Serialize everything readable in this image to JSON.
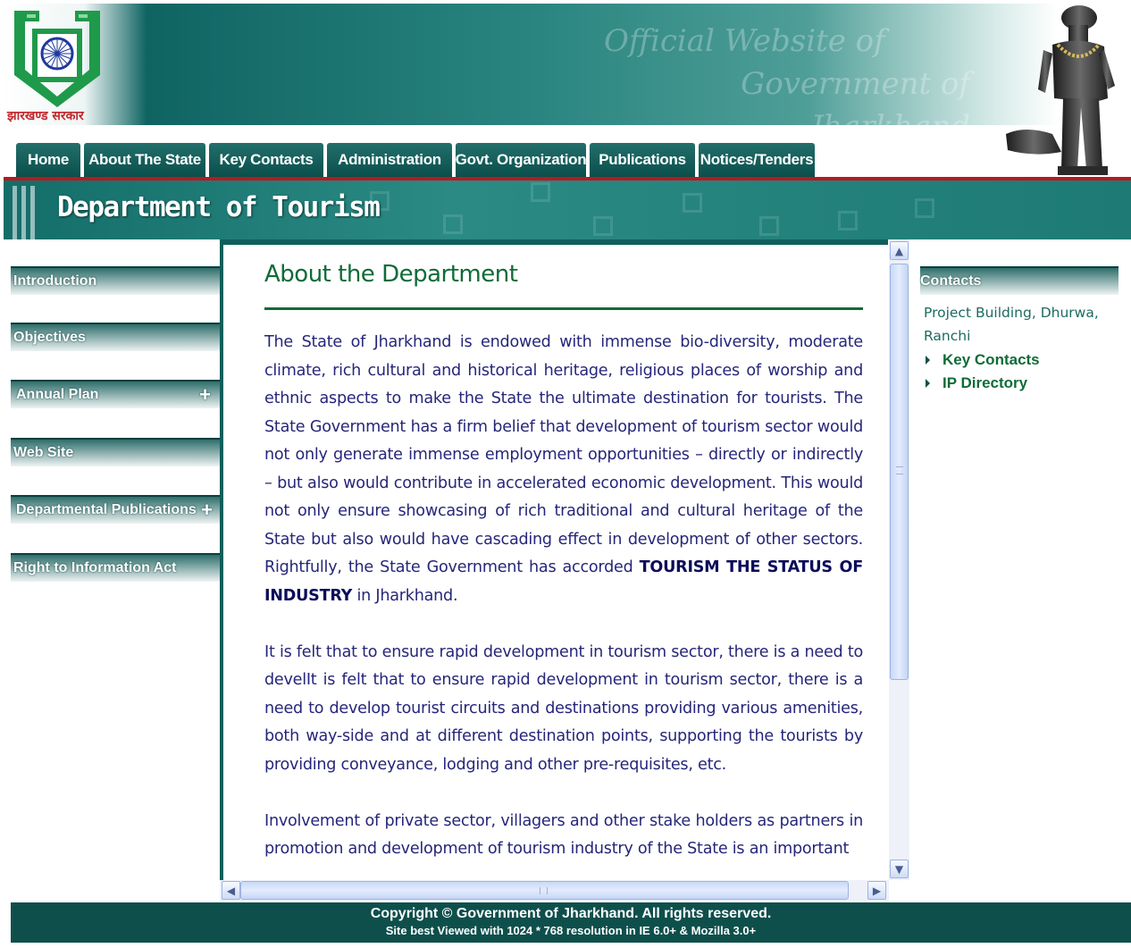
{
  "header": {
    "logo_caption": "झारखण्ड सरकार",
    "official_line1": "Official Website of",
    "official_line2": "Government of Jharkhand"
  },
  "nav": {
    "tabs": [
      {
        "label": "Home"
      },
      {
        "label": "About The State"
      },
      {
        "label": "Key Contacts"
      },
      {
        "label": "Administration"
      },
      {
        "label": "Govt. Organization"
      },
      {
        "label": "Publications"
      },
      {
        "label": "Notices/Tenders"
      }
    ]
  },
  "banner": {
    "title": "Department of Tourism"
  },
  "sidebar": {
    "items": [
      {
        "label": "Introduction"
      },
      {
        "label": "Objectives"
      },
      {
        "label": "Annual Plan",
        "expand": "+"
      },
      {
        "label": "Web Site"
      },
      {
        "label": "Departmental Publications",
        "expand": "+"
      },
      {
        "label": "Right to Information Act"
      }
    ]
  },
  "content": {
    "title": "About the Department",
    "para1_before": "The State of Jharkhand is endowed with immense bio-diversity, moderate climate, rich cultural and historical heritage, religious places of worship and ethnic aspects to make the State the ultimate destination for tourists. The State Government has a firm belief that development of tourism sector would not only generate immense employment opportunities – directly or indirectly – but also would contribute in accelerated economic development. This would not only ensure showcasing of rich traditional and cultural heritage of the State but also would have cascading effect in development of other sectors. Rightfully, the State Government has accorded ",
    "para1_bold": "TOURISM THE STATUS OF INDUSTRY",
    "para1_after": " in Jharkhand.",
    "para2": "It is felt that to ensure rapid development in tourism sector, there is a need to develIt is felt that to ensure rapid development in tourism sector, there is a need to develop tourist circuits and destinations providing various amenities, both way-side and at different destination points, supporting the tourists by providing conveyance, lodging and other pre-requisites, etc.",
    "para3": "Involvement of private sector, villagers and other stake holders as partners in promotion and development of tourism industry of the State is an important"
  },
  "contacts": {
    "heading": "Contacts",
    "address": "Project Building, Dhurwa, Ranchi",
    "links": [
      {
        "label": "Key Contacts"
      },
      {
        "label": "IP Directory"
      }
    ]
  },
  "footer": {
    "copyright": "Copyright © Government of Jharkhand. All rights reserved.",
    "best_viewed": "Site best Viewed with 1024 * 768 resolution in IE 6.0+ & Mozilla 3.0+"
  },
  "colors": {
    "brand_teal": "#0e5f5c",
    "accent_red": "#b8191e",
    "heading_green": "#0f6b38",
    "body_text": "#26267a"
  }
}
